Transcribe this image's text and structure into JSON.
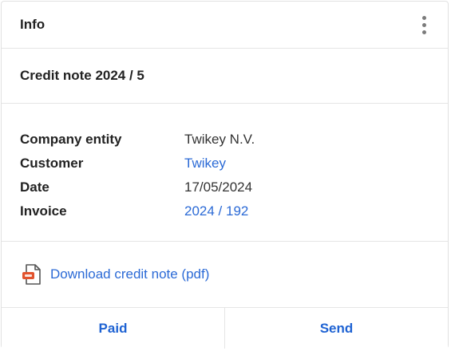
{
  "header": {
    "title": "Info",
    "menu_icon": "more-vertical-icon"
  },
  "document": {
    "title": "Credit note 2024 / 5"
  },
  "details": [
    {
      "label": "Company entity",
      "value": "Twikey N.V.",
      "is_link": false
    },
    {
      "label": "Customer",
      "value": "Twikey",
      "is_link": true
    },
    {
      "label": "Date",
      "value": "17/05/2024",
      "is_link": false
    },
    {
      "label": "Invoice",
      "value": "2024 / 192",
      "is_link": true
    }
  ],
  "download": {
    "icon": "pdf-file-icon",
    "label": "Download credit note (pdf)"
  },
  "actions": {
    "paid_label": "Paid",
    "send_label": "Send"
  },
  "colors": {
    "link": "#2b6ad6",
    "action": "#1f63d3",
    "pdf_accent": "#e2532d"
  }
}
